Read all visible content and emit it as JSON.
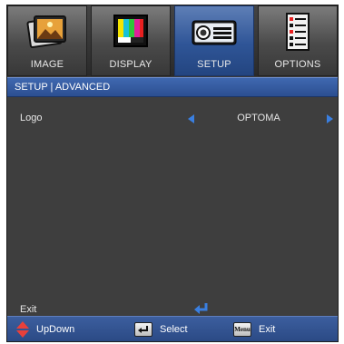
{
  "tabs": [
    {
      "label": "IMAGE",
      "icon": "image-landscape-icon",
      "active": false
    },
    {
      "label": "DISPLAY",
      "icon": "display-color-bars-icon",
      "active": false
    },
    {
      "label": "SETUP",
      "icon": "projector-icon",
      "active": true
    },
    {
      "label": "OPTIONS",
      "icon": "options-list-icon",
      "active": false
    }
  ],
  "header": {
    "breadcrumb": "SETUP | ADVANCED"
  },
  "menu": {
    "logo_label": "Logo",
    "logo_value": "OPTOMA",
    "exit_label": "Exit"
  },
  "footer": {
    "updown_label": "UpDown",
    "select_label": "Select",
    "menu_key": "Menu",
    "exit_label": "Exit"
  },
  "colors": {
    "active_tab": "#2f5597",
    "header_bar": "#3f68b0",
    "arrow": "#3a7fe0",
    "updown_icon": "#e8403a"
  }
}
